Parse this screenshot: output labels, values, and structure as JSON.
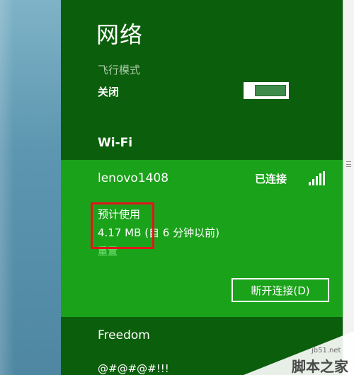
{
  "panel": {
    "title": "网络",
    "airplane_mode": {
      "label": "飞行模式",
      "state": "关闭"
    },
    "wifi_header": "Wi-Fi"
  },
  "connected_network": {
    "name": "lenovo1408",
    "status": "已连接",
    "usage_label": "预计使用",
    "usage_amount": "4.17 MB",
    "usage_since": "(自 6 分钟以前)",
    "reset_link": "重置",
    "disconnect_button": "断开连接(D)"
  },
  "other_networks": [
    {
      "name": "Freedom"
    },
    {
      "name": "@#@#@#!!!"
    }
  ],
  "watermark": {
    "url": "jb51.net",
    "brand": "脚本之家"
  },
  "colors": {
    "panel_bg": "#0b5e0b",
    "connected_card_bg": "#1aa21a",
    "highlight_border": "#e0161d"
  }
}
